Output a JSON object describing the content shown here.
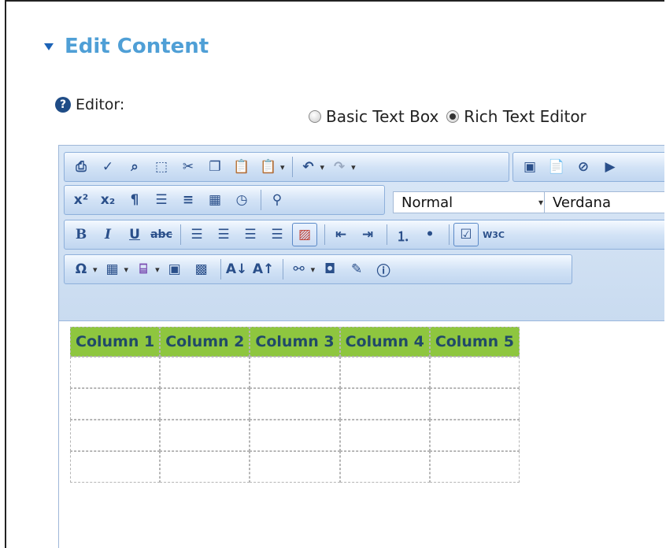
{
  "section": {
    "title": "Edit Content"
  },
  "editor_label": "Editor:",
  "mode": {
    "basic_label": "Basic Text Box",
    "rich_label": "Rich Text Editor",
    "selected": "rich"
  },
  "toolbar": {
    "style_value": "Normal",
    "font_value": "Verdana",
    "icons_row1": [
      "print-icon",
      "spellcheck-icon",
      "find-icon",
      "select-all-icon",
      "cut-icon",
      "copy-icon",
      "paste-icon",
      "paste-options-icon",
      "undo-icon",
      "redo-icon"
    ],
    "icons_row1b": [
      "image-icon",
      "document-icon",
      "flash-icon",
      "media-icon"
    ],
    "icons_row2": [
      "superscript-icon",
      "subscript-icon",
      "paragraph-icon",
      "insert-form-icon",
      "horizontal-rule-icon",
      "insert-date-icon",
      "insert-time-icon",
      "format-painter-icon"
    ],
    "icons_row3": [
      "bold-icon",
      "italic-icon",
      "underline-icon",
      "strikethrough-icon",
      "align-left-icon",
      "align-center-icon",
      "align-right-icon",
      "justify-icon",
      "clear-format-icon",
      "outdent-icon",
      "indent-icon",
      "numbered-list-icon",
      "bullet-list-icon",
      "validate-icon",
      "w3c-icon"
    ],
    "icons_row4": [
      "special-char-icon",
      "table-icon",
      "template-icon",
      "image-manager-icon",
      "image-map-icon",
      "text-case-icon",
      "font-size-icon",
      "hyperlink-icon",
      "bookmark-icon",
      "edit-icon",
      "info-icon"
    ]
  },
  "table": {
    "headers": [
      "Column 1",
      "Column 2",
      "Column 3",
      "Column 4",
      "Column 5"
    ],
    "rows": 4
  }
}
